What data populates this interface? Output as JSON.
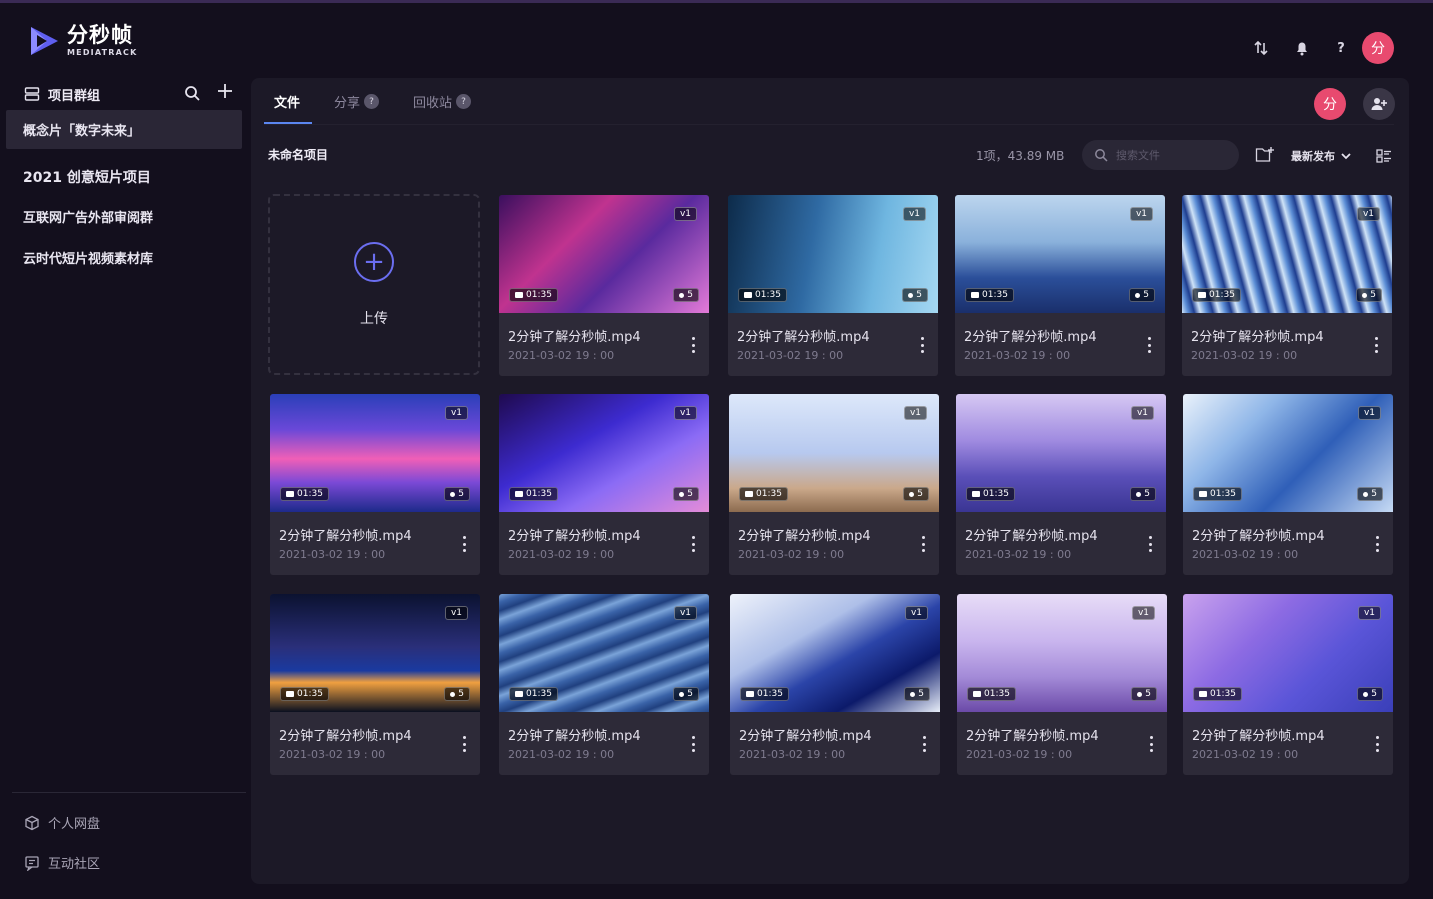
{
  "brand": {
    "name_cn": "分秒帧",
    "name_en": "MEDIATRACK"
  },
  "header": {
    "icons": [
      "transfer-icon",
      "bell-icon",
      "help-icon"
    ],
    "avatar": "分",
    "help": "?"
  },
  "sidebar": {
    "title": "项目群组",
    "items": [
      {
        "label": "概念片「数字未来」",
        "active": true
      },
      {
        "label": "2021 创意短片项目"
      },
      {
        "label": "互联网广告外部审阅群"
      },
      {
        "label": "云时代短片视频素材库"
      }
    ],
    "bottom": [
      {
        "label": "个人网盘",
        "icon": "box-icon"
      },
      {
        "label": "互动社区",
        "icon": "chat-icon"
      }
    ]
  },
  "tabs": [
    {
      "label": "文件",
      "active": true
    },
    {
      "label": "分享",
      "badge": "?"
    },
    {
      "label": "回收站",
      "badge": "?"
    }
  ],
  "collab": {
    "avatar": "分"
  },
  "toolbar": {
    "project_title": "未命名项目",
    "stats": "1项，43.89 MB",
    "search_placeholder": "搜索文件",
    "sort_label": "最新发布"
  },
  "upload": {
    "label": "上传",
    "plus": "+"
  },
  "colors": {
    "accent": "#5b86f0",
    "avatar": "#e84a6f",
    "upload": "#6b6ef0"
  },
  "files": [
    {
      "name": "2分钟了解分秒帧.mp4",
      "date": "2021-03-02 19 : 00",
      "version": "v1",
      "duration": "01:35",
      "comments": "5"
    },
    {
      "name": "2分钟了解分秒帧.mp4",
      "date": "2021-03-02 19 : 00",
      "version": "v1",
      "duration": "01:35",
      "comments": "5"
    },
    {
      "name": "2分钟了解分秒帧.mp4",
      "date": "2021-03-02 19 : 00",
      "version": "v1",
      "duration": "01:35",
      "comments": "5"
    },
    {
      "name": "2分钟了解分秒帧.mp4",
      "date": "2021-03-02 19 : 00",
      "version": "v1",
      "duration": "01:35",
      "comments": "5"
    },
    {
      "name": "2分钟了解分秒帧.mp4",
      "date": "2021-03-02 19 : 00",
      "version": "v1",
      "duration": "01:35",
      "comments": "5"
    },
    {
      "name": "2分钟了解分秒帧.mp4",
      "date": "2021-03-02 19 : 00",
      "version": "v1",
      "duration": "01:35",
      "comments": "5"
    },
    {
      "name": "2分钟了解分秒帧.mp4",
      "date": "2021-03-02 19 : 00",
      "version": "v1",
      "duration": "01:35",
      "comments": "5"
    },
    {
      "name": "2分钟了解分秒帧.mp4",
      "date": "2021-03-02 19 : 00",
      "version": "v1",
      "duration": "01:35",
      "comments": "5"
    },
    {
      "name": "2分钟了解分秒帧.mp4",
      "date": "2021-03-02 19 : 00",
      "version": "v1",
      "duration": "01:35",
      "comments": "5"
    },
    {
      "name": "2分钟了解分秒帧.mp4",
      "date": "2021-03-02 19 : 00",
      "version": "v1",
      "duration": "01:35",
      "comments": "5"
    },
    {
      "name": "2分钟了解分秒帧.mp4",
      "date": "2021-03-02 19 : 00",
      "version": "v1",
      "duration": "01:35",
      "comments": "5"
    },
    {
      "name": "2分钟了解分秒帧.mp4",
      "date": "2021-03-02 19 : 00",
      "version": "v1",
      "duration": "01:35",
      "comments": "5"
    },
    {
      "name": "2分钟了解分秒帧.mp4",
      "date": "2021-03-02 19 : 00",
      "version": "v1",
      "duration": "01:35",
      "comments": "5"
    },
    {
      "name": "2分钟了解分秒帧.mp4",
      "date": "2021-03-02 19 : 00",
      "version": "v1",
      "duration": "01:35",
      "comments": "5"
    }
  ]
}
